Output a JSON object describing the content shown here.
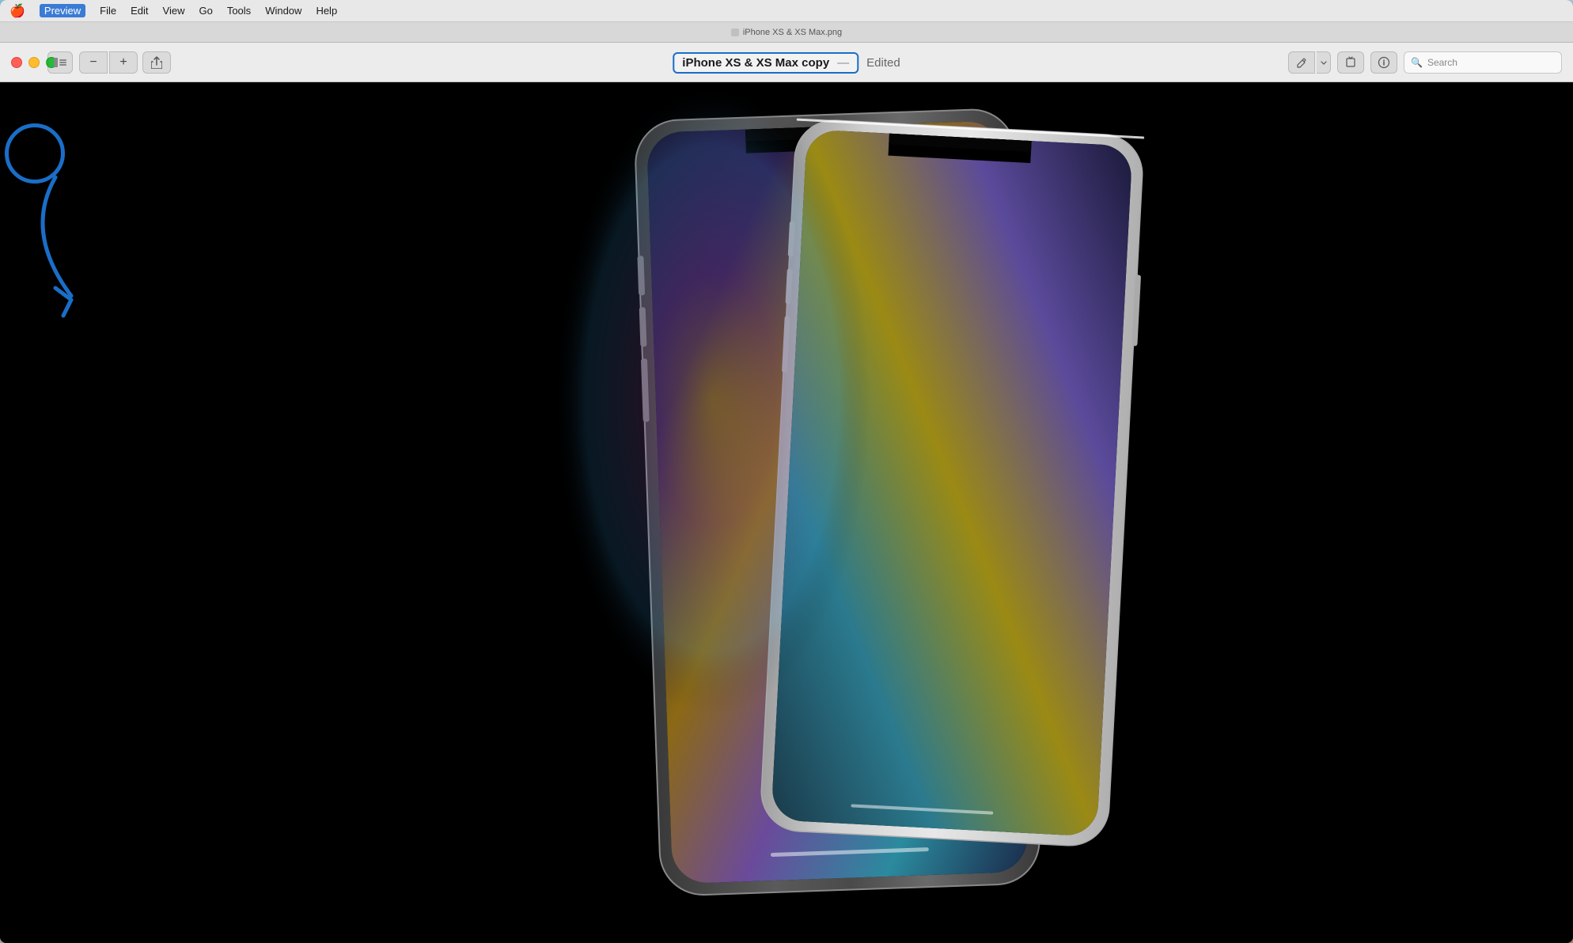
{
  "desktop": {
    "bg_gradient_start": "#87CEEB",
    "bg_gradient_end": "#c8a882"
  },
  "menu_bar": {
    "apple_icon": "🍎",
    "items": [
      {
        "label": "Preview",
        "active": true
      },
      {
        "label": "File"
      },
      {
        "label": "Edit"
      },
      {
        "label": "View"
      },
      {
        "label": "Go"
      },
      {
        "label": "Tools"
      },
      {
        "label": "Window"
      },
      {
        "label": "Help"
      }
    ]
  },
  "tab_bar": {
    "filename": "iPhone XS & XS Max.png",
    "icon": "file-icon"
  },
  "toolbar": {
    "window_controls": {
      "close_label": "close",
      "minimize_label": "minimize",
      "maximize_label": "maximize"
    },
    "sidebar_toggle_icon": "sidebar-icon",
    "zoom_out_icon": "−",
    "zoom_in_icon": "+",
    "share_icon": "↑",
    "title": {
      "filename": "iPhone XS & XS Max copy",
      "separator": "—",
      "edited": "Edited"
    },
    "markup_icon": "✏",
    "markup_chevron_icon": "chevron-down",
    "rotate_icon": "↩",
    "search": {
      "icon": "🔍",
      "placeholder": "Search"
    }
  },
  "main_content": {
    "bg_color": "#000000",
    "image_description": "iPhone XS and XS Max on black background"
  },
  "annotation": {
    "circle_color": "#1a6ec8",
    "arrow_color": "#1a6ec8",
    "target": "window-controls"
  }
}
